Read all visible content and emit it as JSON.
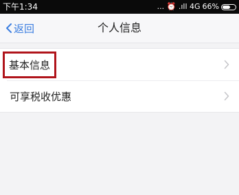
{
  "status_bar": {
    "time": "下午1:34",
    "indicators": "... ⏰ .ıll 4G",
    "battery_percent": "66%",
    "battery_level": 0.66
  },
  "nav": {
    "back_label": "返回",
    "title": "个人信息"
  },
  "menu": {
    "items": [
      {
        "label": "基本信息",
        "highlighted": true,
        "icon": "chevron-right-icon"
      },
      {
        "label": "可享税收优惠",
        "highlighted": false,
        "icon": "chevron-right-icon"
      }
    ]
  },
  "colors": {
    "accent": "#3a7de0",
    "highlight_border": "#b0141b",
    "status_bar_bg": "#0a0a0a",
    "page_bg": "#f3f3f5"
  }
}
